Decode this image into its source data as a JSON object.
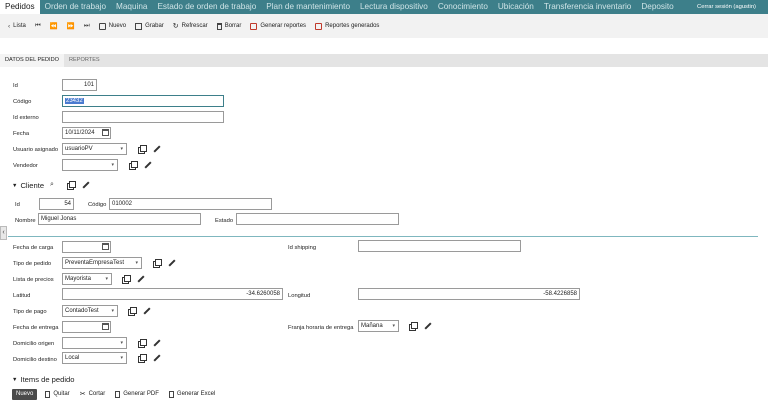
{
  "nav": {
    "tabs": [
      "Pedidos",
      "Orden de trabajo",
      "Maquina",
      "Estado de orden de trabajo",
      "Plan de mantenimiento",
      "Lectura dispositivo",
      "Conocimiento",
      "Ubicación",
      "Transferencia inventario",
      "Deposito"
    ],
    "logout": "Cerrar sesión (agustin)"
  },
  "toolbar": {
    "lista": "Lista",
    "nuevo": "Nuevo",
    "grabar": "Grabar",
    "refrescar": "Refrescar",
    "borrar": "Borrar",
    "generar_reportes": "Generar reportes",
    "reportes_generados": "Reportes generados"
  },
  "subtabs": [
    "DATOS DEL PEDIDO",
    "REPORTES"
  ],
  "form": {
    "id_label": "Id",
    "id_value": "101",
    "codigo_label": "Código",
    "codigo_value": "23432",
    "id_externo_label": "Id externo",
    "id_externo_value": "",
    "fecha_label": "Fecha",
    "fecha_value": "10/11/2024",
    "usuario_label": "Usuario asignado",
    "usuario_value": "usuarioPV",
    "vendedor_label": "Vendedor",
    "vendedor_value": ""
  },
  "cliente": {
    "title": "Cliente",
    "id_label": "Id",
    "id_value": "54",
    "codigo_label": "Código",
    "codigo_value": "010002",
    "nombre_label": "Nombre",
    "nombre_value": "Miguel Jonas",
    "estado_label": "Estado",
    "estado_value": ""
  },
  "pedido": {
    "fecha_carga_label": "Fecha de carga",
    "id_shipping_label": "Id shipping",
    "tipo_pedido_label": "Tipo de pedido",
    "tipo_pedido_value": "PreventaEmpresaTest",
    "lista_precios_label": "Lista de precios",
    "lista_precios_value": "Mayorista",
    "latitud_label": "Latitud",
    "latitud_value": "-34.6260058",
    "longitud_label": "Longitud",
    "longitud_value": "-58.4226858",
    "tipo_pago_label": "Tipo de pago",
    "tipo_pago_value": "ContadoTest",
    "fecha_entrega_label": "Fecha de entrega",
    "franja_label": "Franja horaria de entrega",
    "franja_value": "Mañana",
    "domicilio_origen_label": "Domicilio origen",
    "domicilio_origen_value": "",
    "domicilio_destino_label": "Domicilio destino",
    "domicilio_destino_value": "Local"
  },
  "items": {
    "title": "Items de pedido",
    "nuevo": "Nuevo",
    "quitar": "Quitar",
    "cortar": "Cortar",
    "generar_pdf": "Generar PDF",
    "generar_excel": "Generar Excel"
  }
}
